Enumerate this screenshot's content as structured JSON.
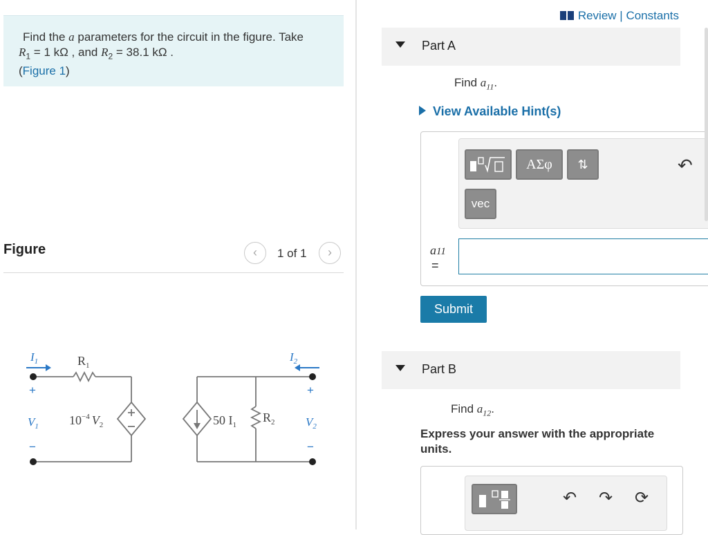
{
  "problem": {
    "line1_pre": "Find the ",
    "line1_var": "a",
    "line1_post": " parameters for the circuit in the figure. Take",
    "r1_symbol": "R",
    "r1_sub": "1",
    "r1_value": " = 1 kΩ , and ",
    "r2_symbol": "R",
    "r2_sub": "2",
    "r2_value": " = 38.1 kΩ .",
    "figure_link": "Figure 1"
  },
  "figure": {
    "title": "Figure",
    "counter": "1 of 1",
    "prev_icon": "chevron-left-icon",
    "next_icon": "chevron-right-icon",
    "labels": {
      "i1": "I",
      "i1_sub": "1",
      "r1": "R",
      "r1_sub": "1",
      "v1": "V",
      "v1_sub": "1",
      "dependent_v": "10",
      "dependent_v_exp": "−4",
      "dependent_v_var": "V",
      "dependent_v_sub": "2",
      "dependent_i": "50 I",
      "dependent_i_sub": "1",
      "r2": "R",
      "r2_sub": "2",
      "i2": "I",
      "i2_sub": "2",
      "v2": "V",
      "v2_sub": "2",
      "plus": "+",
      "minus": "−"
    }
  },
  "header_links": {
    "review": "Review",
    "separator": " | ",
    "constants": "Constants"
  },
  "partA": {
    "label": "Part A",
    "find_pre": "Find ",
    "find_var": "a",
    "find_sub": "11",
    "find_post": ".",
    "hint": "View Available Hint(s)",
    "toolbar": {
      "greek": "ΑΣφ",
      "arrows": "⇅",
      "vec": "vec"
    },
    "answer_label_var": "a",
    "answer_label_sub": "11",
    "answer_label_eq": "=",
    "answer_value": "",
    "submit": "Submit"
  },
  "partB": {
    "label": "Part B",
    "find_pre": "Find ",
    "find_var": "a",
    "find_sub": "12",
    "find_post": ".",
    "express": "Express your answer with the appropriate units."
  }
}
